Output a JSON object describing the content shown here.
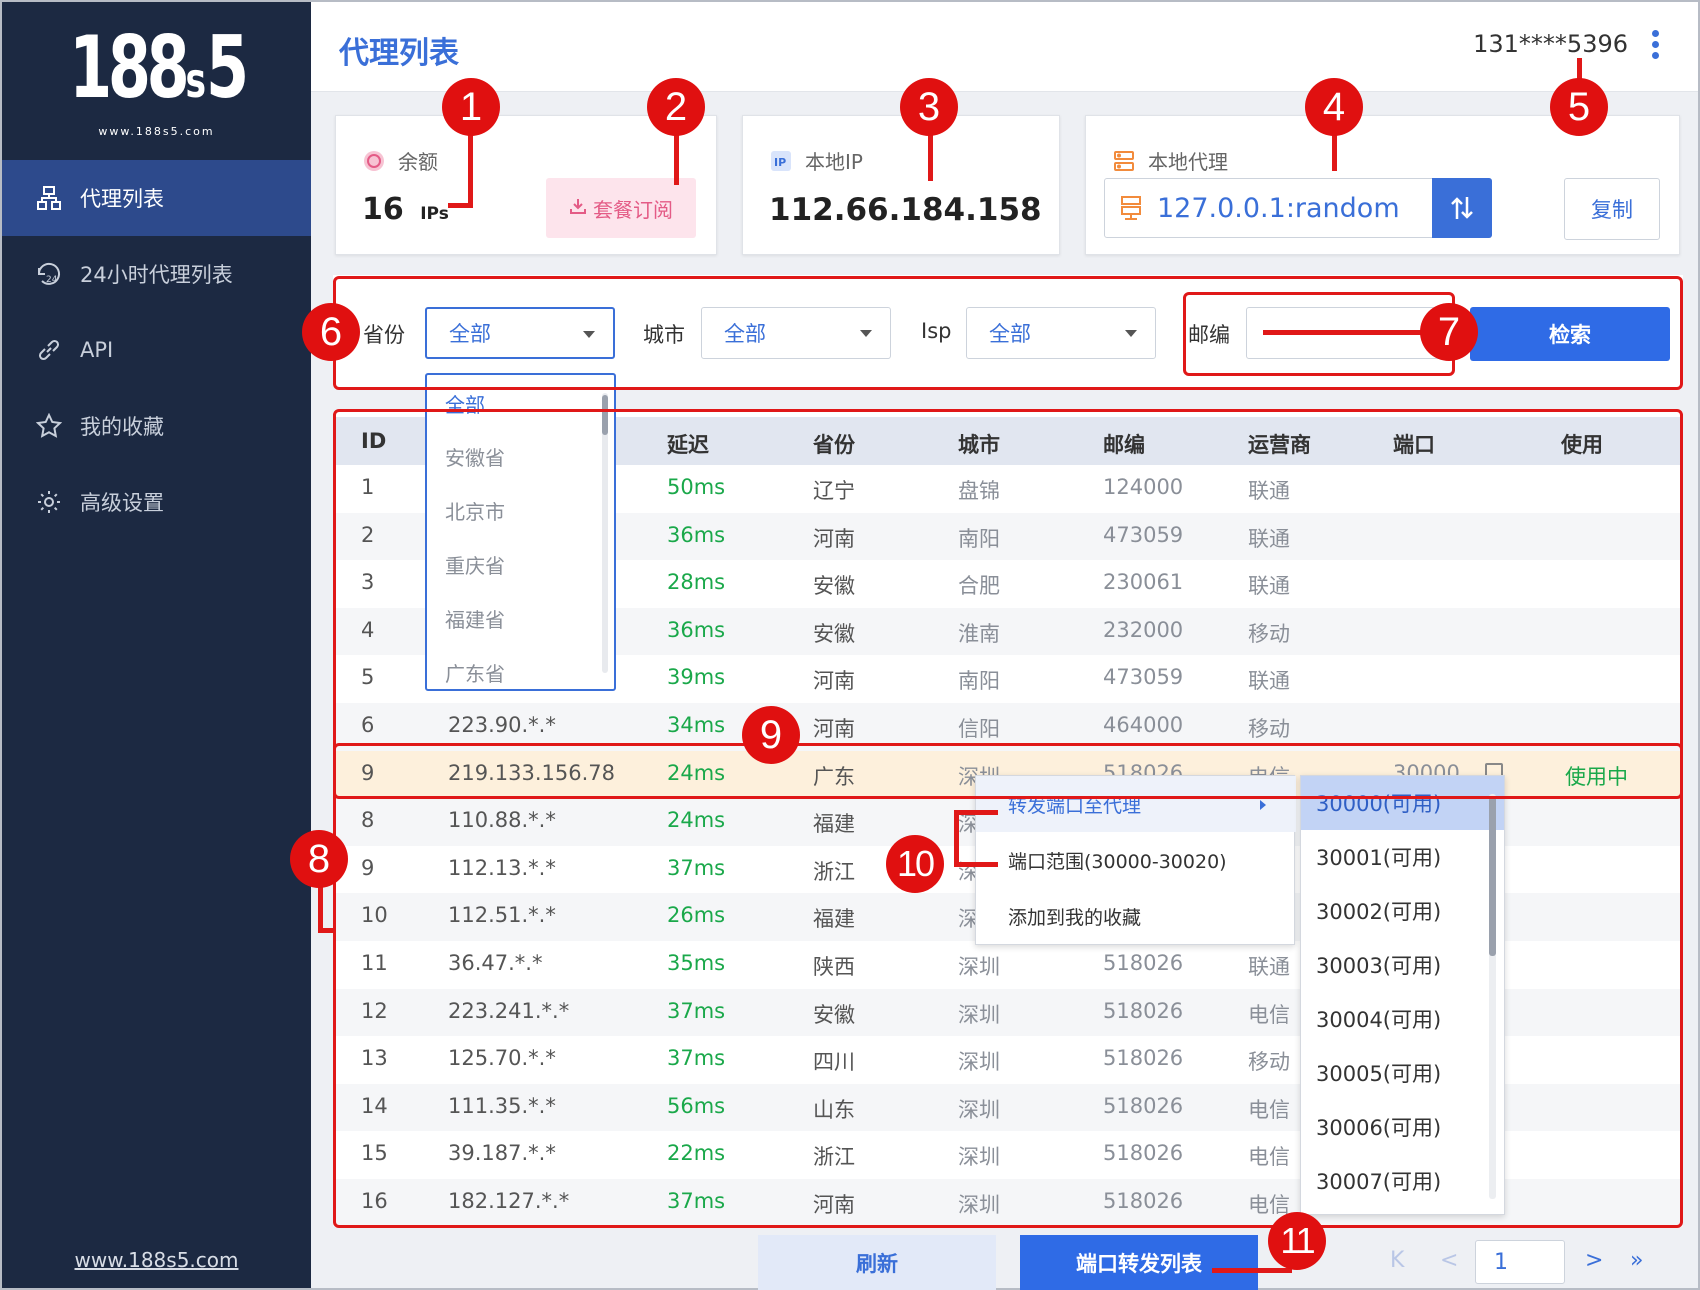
{
  "logo": {
    "main": "188",
    "s": "s",
    "tail": "5",
    "sub": "www.188s5.com"
  },
  "sidebar": {
    "items": [
      {
        "label": "代理列表",
        "icon": "network-icon",
        "active": true
      },
      {
        "label": "24小时代理列表",
        "icon": "clock-24-icon",
        "active": false
      },
      {
        "label": "API",
        "icon": "link-icon",
        "active": false
      },
      {
        "label": "我的收藏",
        "icon": "star-icon",
        "active": false
      },
      {
        "label": "高级设置",
        "icon": "gear-icon",
        "active": false
      }
    ],
    "footer_link": "www.188s5.com"
  },
  "header": {
    "title": "代理列表",
    "user": "131****5396",
    "menu_icon": "more-vertical-icon"
  },
  "cards": {
    "balance": {
      "label": "余额",
      "value": "16",
      "unit": "IPs",
      "button": "套餐订阅"
    },
    "local_ip": {
      "label": "本地IP",
      "value": "112.66.184.158"
    },
    "local_proxy": {
      "label": "本地代理",
      "value": "127.0.0.1:random",
      "copy": "复制"
    }
  },
  "filter": {
    "province_label": "省份",
    "province_value": "全部",
    "city_label": "城市",
    "city_value": "全部",
    "isp_label": "Isp",
    "isp_value": "全部",
    "zip_label": "邮编",
    "zip_value": "",
    "search_button": "检索"
  },
  "province_dropdown": [
    "全部",
    "安徽省",
    "北京市",
    "重庆省",
    "福建省",
    "广东省"
  ],
  "table": {
    "headers": [
      "ID",
      "延迟",
      "省份",
      "城市",
      "邮编",
      "运营商",
      "端口",
      "使用"
    ],
    "rows": [
      {
        "id": "1",
        "ip": "",
        "lat": "50ms",
        "prov": "辽宁",
        "city": "盘锦",
        "zip": "124000",
        "isp": "联通",
        "port": "",
        "use": ""
      },
      {
        "id": "2",
        "ip": "",
        "lat": "36ms",
        "prov": "河南",
        "city": "南阳",
        "zip": "473059",
        "isp": "联通",
        "port": "",
        "use": ""
      },
      {
        "id": "3",
        "ip": "",
        "lat": "28ms",
        "prov": "安徽",
        "city": "合肥",
        "zip": "230061",
        "isp": "联通",
        "port": "",
        "use": ""
      },
      {
        "id": "4",
        "ip": "",
        "lat": "36ms",
        "prov": "安徽",
        "city": "淮南",
        "zip": "232000",
        "isp": "移动",
        "port": "",
        "use": ""
      },
      {
        "id": "5",
        "ip": "",
        "lat": "39ms",
        "prov": "河南",
        "city": "南阳",
        "zip": "473059",
        "isp": "联通",
        "port": "",
        "use": ""
      },
      {
        "id": "6",
        "ip": "223.90.*.*",
        "lat": "34ms",
        "prov": "河南",
        "city": "信阳",
        "zip": "464000",
        "isp": "移动",
        "port": "",
        "use": ""
      },
      {
        "id": "9",
        "ip": "219.133.156.78",
        "lat": "24ms",
        "prov": "广东",
        "city": "深圳",
        "zip": "518026",
        "isp": "电信",
        "port": "30000",
        "use": "使用中"
      },
      {
        "id": "8",
        "ip": "110.88.*.*",
        "lat": "24ms",
        "prov": "福建",
        "city": "深",
        "zip": "",
        "isp": "",
        "port": "",
        "use": ""
      },
      {
        "id": "9",
        "ip": "112.13.*.*",
        "lat": "37ms",
        "prov": "浙江",
        "city": "深",
        "zip": "",
        "isp": "",
        "port": "",
        "use": ""
      },
      {
        "id": "10",
        "ip": "112.51.*.*",
        "lat": "26ms",
        "prov": "福建",
        "city": "深",
        "zip": "",
        "isp": "",
        "port": "",
        "use": ""
      },
      {
        "id": "11",
        "ip": "36.47.*.*",
        "lat": "35ms",
        "prov": "陕西",
        "city": "深圳",
        "zip": "518026",
        "isp": "联通",
        "port": "",
        "use": ""
      },
      {
        "id": "12",
        "ip": "223.241.*.*",
        "lat": "37ms",
        "prov": "安徽",
        "city": "深圳",
        "zip": "518026",
        "isp": "电信",
        "port": "",
        "use": ""
      },
      {
        "id": "13",
        "ip": "125.70.*.*",
        "lat": "37ms",
        "prov": "四川",
        "city": "深圳",
        "zip": "518026",
        "isp": "移动",
        "port": "",
        "use": ""
      },
      {
        "id": "14",
        "ip": "111.35.*.*",
        "lat": "56ms",
        "prov": "山东",
        "city": "深圳",
        "zip": "518026",
        "isp": "电信",
        "port": "",
        "use": ""
      },
      {
        "id": "15",
        "ip": "39.187.*.*",
        "lat": "22ms",
        "prov": "浙江",
        "city": "深圳",
        "zip": "518026",
        "isp": "电信",
        "port": "",
        "use": ""
      },
      {
        "id": "16",
        "ip": "182.127.*.*",
        "lat": "37ms",
        "prov": "河南",
        "city": "深圳",
        "zip": "518026",
        "isp": "电信",
        "port": "",
        "use": ""
      }
    ]
  },
  "context_menu": [
    "转发端口至代理",
    "端口范围(30000-30020)",
    "添加到我的收藏"
  ],
  "ports": [
    "30000(可用)",
    "30001(可用)",
    "30002(可用)",
    "30003(可用)",
    "30004(可用)",
    "30005(可用)",
    "30006(可用)",
    "30007(可用)"
  ],
  "footer": {
    "refresh": "刷新",
    "port_list": "端口转发列表",
    "page": "1",
    "first": "K",
    "prev": "<",
    "next": ">",
    "last": "»"
  },
  "annotations": [
    "1",
    "2",
    "3",
    "4",
    "5",
    "6",
    "7",
    "8",
    "9",
    "10",
    "11"
  ],
  "colors": {
    "sidebar": "#1c2942",
    "accent": "#3a6fd8",
    "latency": "#1aa84a",
    "annotation": "#e01818",
    "highlight": "#fdf0dc"
  }
}
